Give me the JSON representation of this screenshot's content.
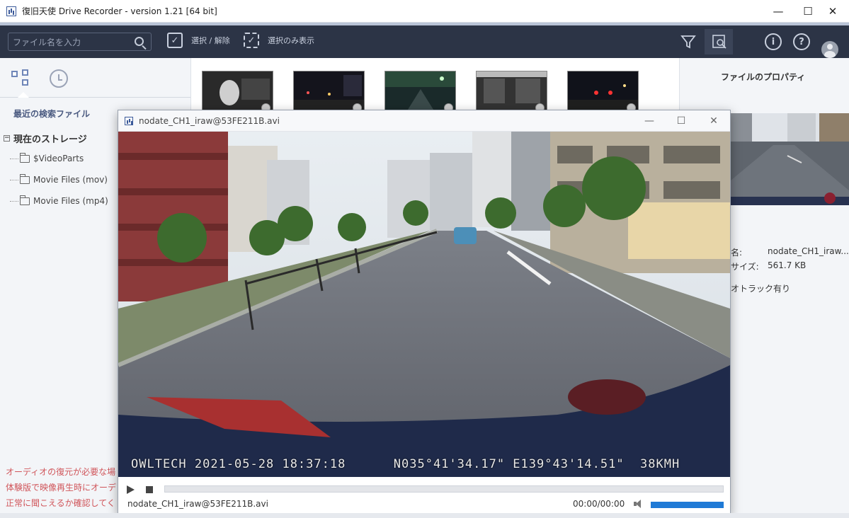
{
  "app": {
    "title": "復旧天使 Drive Recorder - version 1.21 [64 bit]",
    "minimize": "—",
    "maximize": "☐",
    "close": "✕"
  },
  "toolbar": {
    "search_placeholder": "ファイル名を入力",
    "select_toggle_label": "選択 / 解除",
    "show_selected_label": "選択のみ表示"
  },
  "left_panel": {
    "recent_search": "最近の検索ファイル",
    "storage_title": "現在のストレージ",
    "storage_toggle": "−",
    "folders": [
      "$VideoParts",
      "Movie Files (mov)",
      "Movie Files (mp4)"
    ],
    "notes": [
      "オーディオの復元が必要な場",
      "体験版で映像再生時にオーデ",
      "正常に聞こえるか確認してく"
    ]
  },
  "right_panel": {
    "title": "ファイルのプロパティ",
    "name_label": "名:",
    "name_value": "nodate_CH1_iraw...",
    "size_label": "サイズ:",
    "size_value": "561.7 KB",
    "audio_note": "オトラック有り"
  },
  "player": {
    "title": "nodate_CH1_iraw@53FE211B.avi",
    "osd_left": "OWLTECH 2021-05-28 18:37:18",
    "osd_right": "N035°41'34.17\" E139°43'14.51\"  38KMH",
    "filename": "nodate_CH1_iraw@53FE211B.avi",
    "time": "00:00/00:00",
    "minimize": "—",
    "maximize": "☐",
    "close": "✕"
  },
  "colors": {
    "toolbar_bg": "#2c3446",
    "accent_blue": "#1f7ad6",
    "note_red": "#d0555a"
  }
}
